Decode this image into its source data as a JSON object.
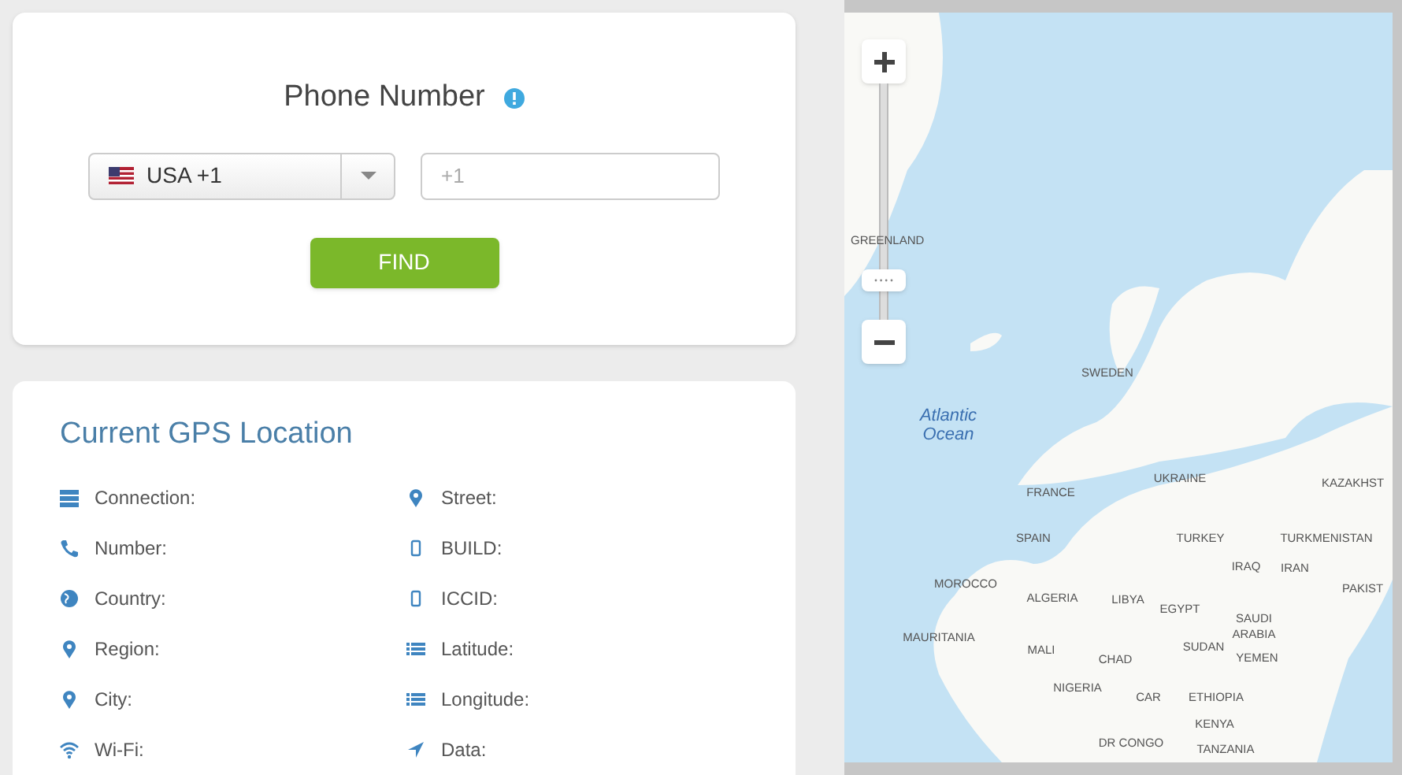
{
  "phone_card": {
    "title": "Phone Number",
    "country_select": {
      "value": "USA +1"
    },
    "phone_field": {
      "placeholder": "+1"
    },
    "find_button": "FIND"
  },
  "gps_card": {
    "title": "Current GPS Location",
    "left_fields": [
      "Connection:",
      "Number:",
      "Country:",
      "Region:",
      "City:",
      "Wi-Fi:"
    ],
    "right_fields": [
      "Street:",
      "BUILD:",
      "ICCID:",
      "Latitude:",
      "Longitude:",
      "Data:"
    ]
  },
  "map": {
    "zoom_slider": {
      "level": 0.13
    },
    "labels": [
      "GREENLAND",
      "Atlantic Ocean",
      "SWEDEN",
      "UKRAINE",
      "FRANCE",
      "KAZAKHST",
      "SPAIN",
      "TURKEY",
      "TURKMENISTAN",
      "IRAQ",
      "IRAN",
      "PAKIST",
      "MOROCCO",
      "ALGERIA",
      "LIBYA",
      "EGYPT",
      "SAUDI ARABIA",
      "MAURITANIA",
      "MALI",
      "CHAD",
      "SUDAN",
      "YEMEN",
      "NIGERIA",
      "CAR",
      "ETHIOPIA",
      "KENYA",
      "DR CONGO",
      "TANZANIA"
    ]
  }
}
